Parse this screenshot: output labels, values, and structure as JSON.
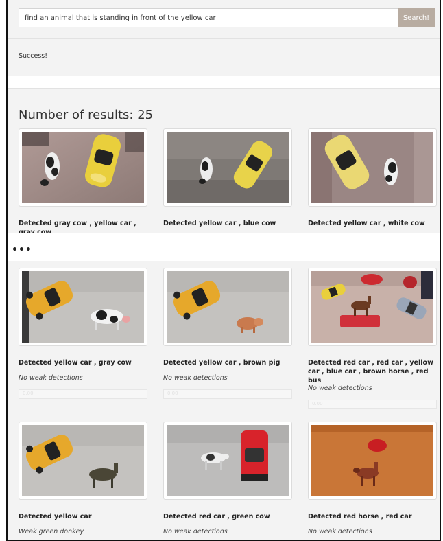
{
  "search": {
    "query": "find an animal that is standing in front of the yellow car",
    "button_label": "Search!"
  },
  "status": "Success!",
  "results_title": "Number of results: 25",
  "ellipsis": "•••",
  "results": [
    {
      "title": "Detected gray cow , yellow car , gray cow",
      "weak": ""
    },
    {
      "title": "Detected yellow car , blue cow",
      "weak": ""
    },
    {
      "title": "Detected yellow car , white cow",
      "weak": ""
    },
    {
      "title": "Detected yellow car , gray cow",
      "weak": "No weak detections",
      "score": "0.00"
    },
    {
      "title": "Detected yellow car , brown pig",
      "weak": "No weak detections",
      "score": "0.00"
    },
    {
      "title": "Detected red car , red car , yellow car , blue car , brown horse , red bus",
      "weak": "No weak detections",
      "score": "0.00"
    },
    {
      "title": "Detected yellow car",
      "weak": "Weak green donkey"
    },
    {
      "title": "Detected red car , green cow",
      "weak": "No weak detections"
    },
    {
      "title": "Detected red horse , red car",
      "weak": "No weak detections"
    }
  ]
}
